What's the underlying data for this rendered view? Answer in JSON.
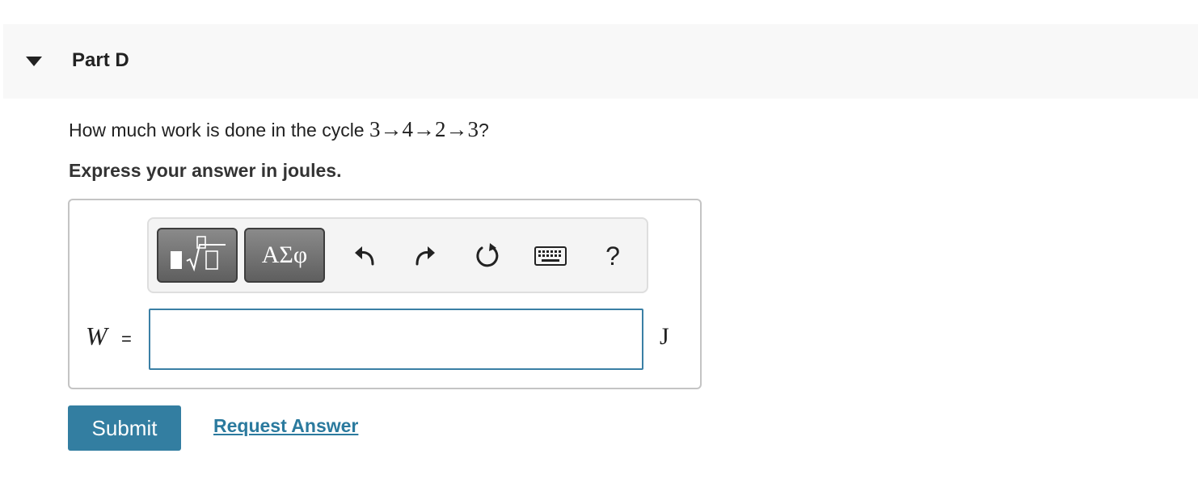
{
  "part": {
    "title": "Part D"
  },
  "question": {
    "prefix": "How much work is done in the cycle ",
    "cycle": "3→4→2→3",
    "suffix": "?"
  },
  "instruction": "Express your answer in joules.",
  "toolbar": {
    "templates_label": "√",
    "greek_label": "ΑΣφ",
    "help_label": "?",
    "icons": [
      "templates-icon",
      "greek-letters-icon",
      "undo-icon",
      "redo-icon",
      "reset-icon",
      "keyboard-icon",
      "help-icon"
    ]
  },
  "answer": {
    "variable": "W",
    "equals": "=",
    "value": "",
    "unit": "J"
  },
  "actions": {
    "submit_label": "Submit",
    "request_label": "Request Answer"
  },
  "colors": {
    "accent": "#337ea1",
    "link": "#2b7a9e",
    "input_border": "#3a7fa5"
  }
}
